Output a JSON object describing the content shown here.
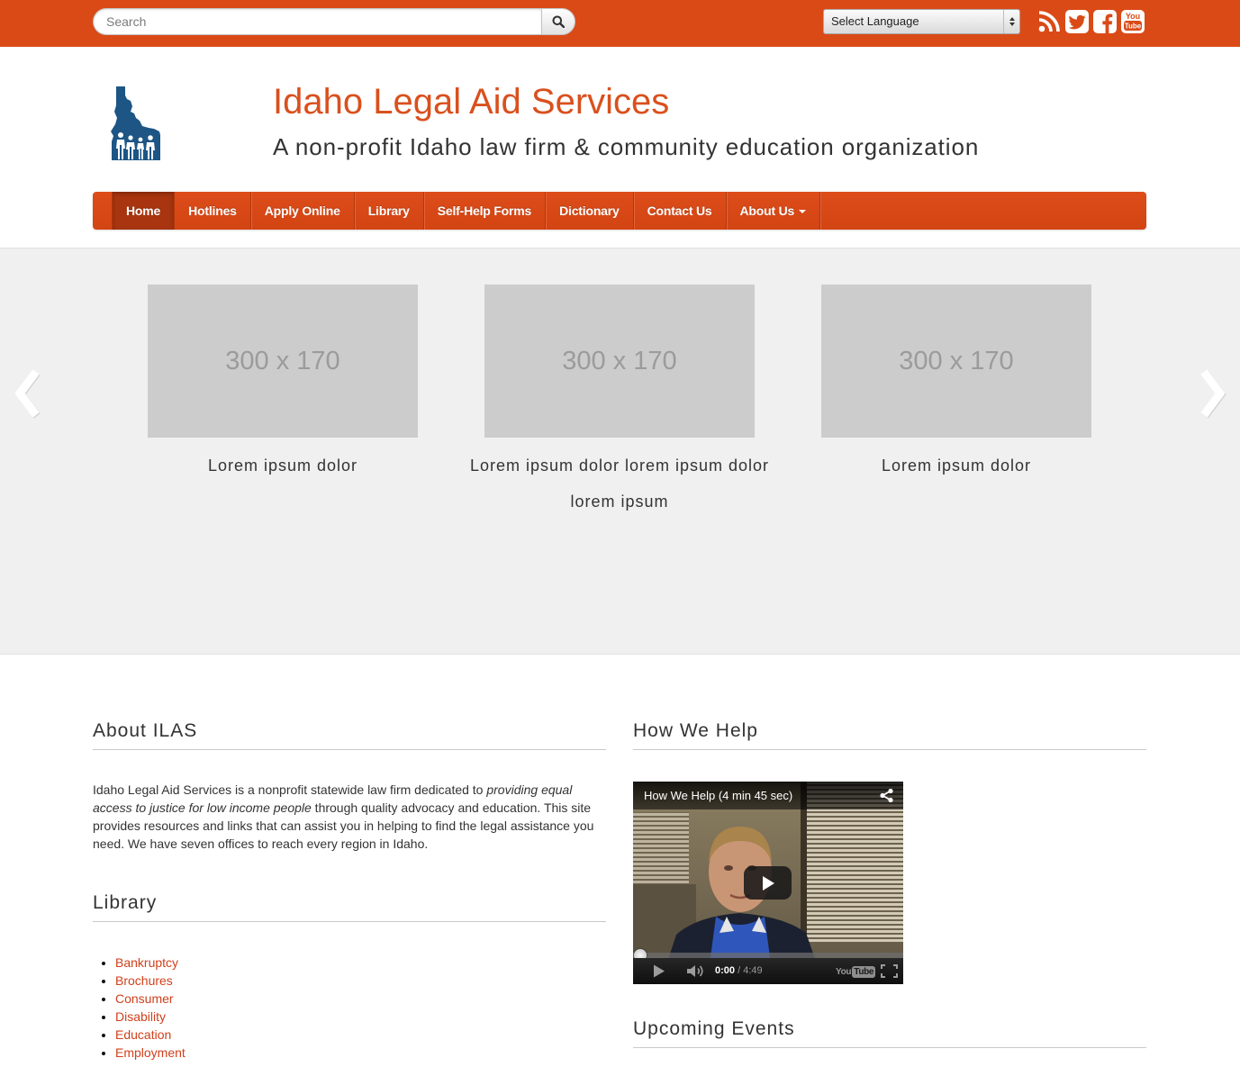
{
  "colors": {
    "brand_orange": "#da4a17",
    "nav_bar": "#d84816",
    "nav_active": "#a8350f",
    "link": "#d0401b",
    "title": "#d9501e",
    "logo_blue": "#1d5585"
  },
  "topbar": {
    "search": {
      "placeholder": "Search",
      "value": "",
      "button_icon": "search-icon"
    },
    "language_select": {
      "selected": "Select Language"
    },
    "social_icons": [
      "rss-icon",
      "twitter-icon",
      "facebook-icon",
      "youtube-icon"
    ],
    "youtube_icon_text": {
      "top": "You",
      "bottom": "Tube"
    }
  },
  "header": {
    "logo_icon": "idaho-state-people-logo",
    "title": "Idaho Legal Aid Services",
    "subtitle": "A non-profit Idaho law firm & community education organization"
  },
  "nav": {
    "items": [
      {
        "label": "Home",
        "active": true
      },
      {
        "label": "Hotlines",
        "active": false
      },
      {
        "label": "Apply Online",
        "active": false
      },
      {
        "label": "Library",
        "active": false
      },
      {
        "label": "Self-Help Forms",
        "active": false
      },
      {
        "label": "Dictionary",
        "active": false
      },
      {
        "label": "Contact Us",
        "active": false
      },
      {
        "label": "About Us",
        "active": false,
        "dropdown": true
      }
    ]
  },
  "carousel": {
    "prev_icon": "chevron-left-icon",
    "next_icon": "chevron-right-icon",
    "slides": [
      {
        "placeholder": "300 x 170",
        "caption": "Lorem ipsum dolor"
      },
      {
        "placeholder": "300 x 170",
        "caption": "Lorem ipsum dolor lorem ipsum dolor lorem ipsum"
      },
      {
        "placeholder": "300 x 170",
        "caption": "Lorem ipsum dolor"
      }
    ]
  },
  "about": {
    "heading": "About ILAS",
    "text_before": "Idaho Legal Aid Services is a nonprofit statewide law firm dedicated to ",
    "text_emphasis": "providing equal access to justice for low income people",
    "text_after": " through quality advocacy and education. This site provides resources and links that can assist you in helping to find the legal assistance you need. We have seven offices to reach every region in Idaho."
  },
  "library": {
    "heading": "Library",
    "items": [
      "Bankruptcy",
      "Brochures",
      "Consumer",
      "Disability",
      "Education",
      "Employment"
    ]
  },
  "how_we_help": {
    "heading": "How We Help",
    "video": {
      "title": "How We Help (4 min 45 sec)",
      "current_time": "0:00",
      "time_separator": " / ",
      "duration": "4:49",
      "progress": 0,
      "player_logo": {
        "first": "You",
        "second": "Tube"
      }
    }
  },
  "events": {
    "heading": "Upcoming Events"
  }
}
